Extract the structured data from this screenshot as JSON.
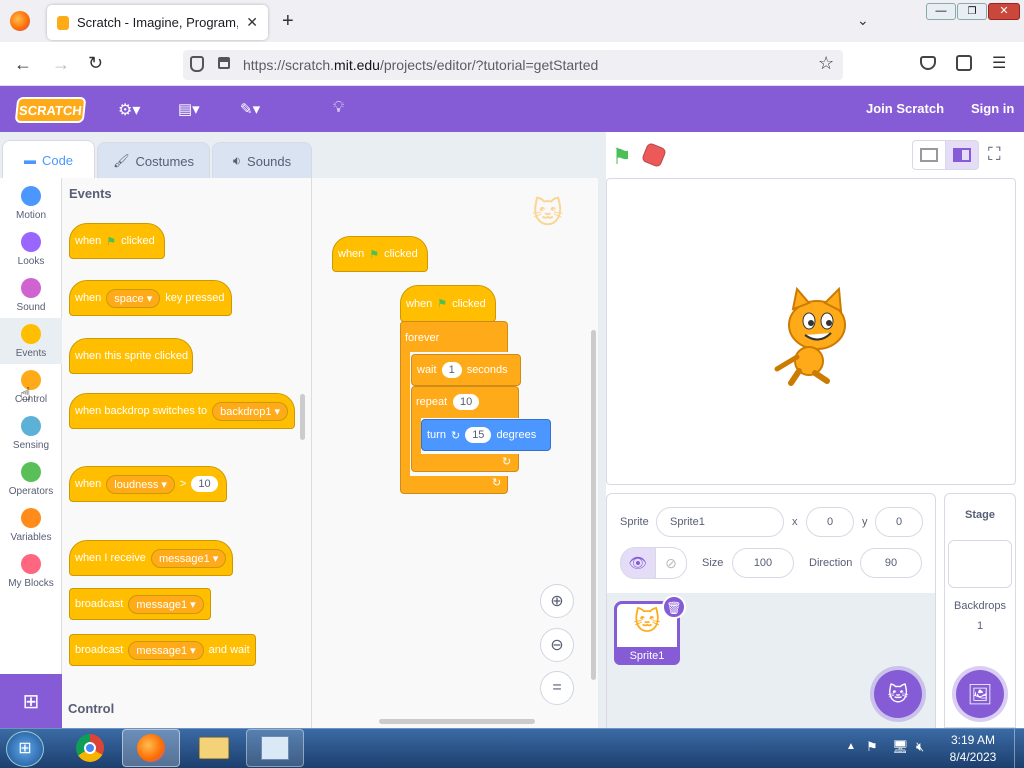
{
  "browser": {
    "tab_title": "Scratch - Imagine, Program, Sh",
    "url_prefix": "https://scratch.",
    "url_host": "mit.edu",
    "url_path": "/projects/editor/?tutorial=getStarted"
  },
  "menu": {
    "logo": "SCRATCH",
    "join": "Join Scratch",
    "signin": "Sign in"
  },
  "tabs": {
    "code": "Code",
    "costumes": "Costumes",
    "sounds": "Sounds"
  },
  "categories": [
    {
      "label": "Motion",
      "color": "#4c97ff"
    },
    {
      "label": "Looks",
      "color": "#9966ff"
    },
    {
      "label": "Sound",
      "color": "#cf63cf"
    },
    {
      "label": "Events",
      "color": "#ffbf00"
    },
    {
      "label": "Control",
      "color": "#ffab19"
    },
    {
      "label": "Sensing",
      "color": "#5cb1d6"
    },
    {
      "label": "Operators",
      "color": "#59c059"
    },
    {
      "label": "Variables",
      "color": "#ff8c1a"
    },
    {
      "label": "My Blocks",
      "color": "#ff6680"
    }
  ],
  "palette": {
    "events_heading": "Events",
    "control_heading": "Control",
    "b_flag_when": "when",
    "b_flag_clicked": "clicked",
    "b_key_when": "when",
    "b_key_value": "space",
    "b_key_rest": "key pressed",
    "b_sprite_clicked": "when this sprite clicked",
    "b_backdrop": "when backdrop switches to",
    "b_backdrop_value": "backdrop1",
    "b_loud_when": "when",
    "b_loud_value": "loudness",
    "b_loud_op": ">",
    "b_loud_num": "10",
    "b_receive": "when I receive",
    "b_receive_value": "message1",
    "b_broadcast": "broadcast",
    "b_broadcast_value": "message1",
    "b_broadcastwait": "broadcast",
    "b_broadcastwait_value": "message1",
    "b_broadcastwait_rest": "and wait"
  },
  "script": {
    "h1_when": "when",
    "h1_clicked": "clicked",
    "h2_when": "when",
    "h2_clicked": "clicked",
    "forever": "forever",
    "wait": "wait",
    "wait_val": "1",
    "seconds": "seconds",
    "repeat": "repeat",
    "repeat_val": "10",
    "turn": "turn",
    "turn_val": "15",
    "degrees": "degrees"
  },
  "sprite_info": {
    "sprite_label": "Sprite",
    "sprite_name": "Sprite1",
    "x_label": "x",
    "x": "0",
    "y_label": "y",
    "y": "0",
    "size_label": "Size",
    "size": "100",
    "direction_label": "Direction",
    "direction": "90",
    "thumb_name": "Sprite1"
  },
  "stage_panel": {
    "title": "Stage",
    "backdrops_label": "Backdrops",
    "backdrops_count": "1"
  },
  "taskbar": {
    "time": "3:19 AM",
    "date": "8/4/2023"
  }
}
